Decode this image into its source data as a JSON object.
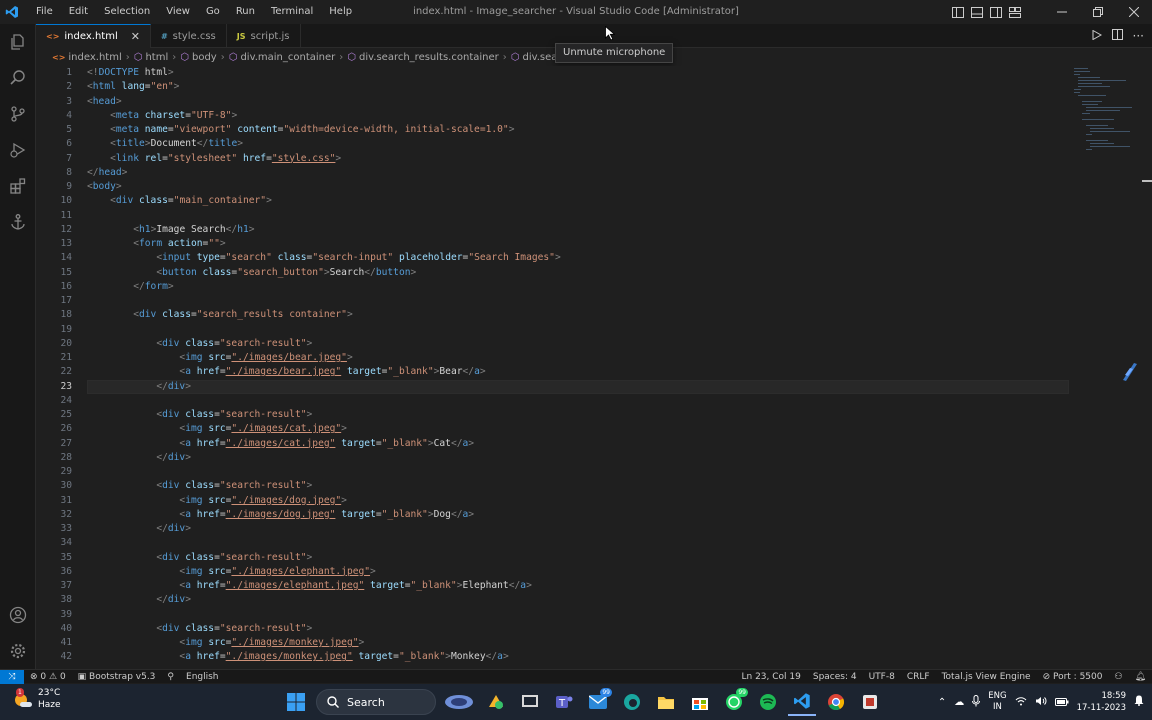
{
  "window": {
    "title": "index.html - Image_searcher - Visual Studio Code [Administrator]",
    "menu": [
      "File",
      "Edit",
      "Selection",
      "View",
      "Go",
      "Run",
      "Terminal",
      "Help"
    ]
  },
  "tabs": [
    {
      "label": "index.html",
      "icon": "<>",
      "active": true
    },
    {
      "label": "style.css",
      "icon": "#",
      "active": false
    },
    {
      "label": "script.js",
      "icon": "JS",
      "active": false
    }
  ],
  "breadcrumb": [
    "index.html",
    "html",
    "body",
    "div.main_container",
    "div.search_results.container",
    "div.search-result"
  ],
  "tooltip": "Unmute microphone",
  "editor": {
    "current_line": 23,
    "line_numbers": [
      "1",
      "2",
      "3",
      "4",
      "5",
      "6",
      "7",
      "8",
      "9",
      "10",
      "11",
      "12",
      "13",
      "14",
      "15",
      "16",
      "17",
      "18",
      "19",
      "20",
      "21",
      "22",
      "23",
      "24",
      "25",
      "26",
      "27",
      "28",
      "29",
      "30",
      "31",
      "32",
      "33",
      "34",
      "35",
      "36",
      "37",
      "38",
      "39",
      "40",
      "41",
      "42"
    ],
    "lines": [
      "<!DOCTYPE html>",
      "<html lang=\"en\">",
      "<head>",
      "    <meta charset=\"UTF-8\">",
      "    <meta name=\"viewport\" content=\"width=device-width, initial-scale=1.0\">",
      "    <title>Document</title>",
      "    <link rel=\"stylesheet\" href=\"style.css\">",
      "</head>",
      "<body>",
      "    <div class=\"main_container\">",
      "",
      "        <h1>Image Search</h1>",
      "        <form action=\"\">",
      "            <input type=\"search\" class=\"search-input\" placeholder=\"Search Images\">",
      "            <button class=\"search_button\">Search</button>",
      "        </form>",
      "",
      "        <div class=\"search_results container\">",
      "",
      "            <div class=\"search-result\">",
      "                <img src=\"./images/bear.jpeg\">",
      "                <a href=\"./images/bear.jpeg\" target=\"_blank\">Bear</a>",
      "            </div>",
      "",
      "            <div class=\"search-result\">",
      "                <img src=\"./images/cat.jpeg\">",
      "                <a href=\"./images/cat.jpeg\" target=\"_blank\">Cat</a>",
      "            </div>",
      "",
      "            <div class=\"search-result\">",
      "                <img src=\"./images/dog.jpeg\">",
      "                <a href=\"./images/dog.jpeg\" target=\"_blank\">Dog</a>",
      "            </div>",
      "",
      "            <div class=\"search-result\">",
      "                <img src=\"./images/elephant.jpeg\">",
      "                <a href=\"./images/elephant.jpeg\" target=\"_blank\">Elephant</a>",
      "            </div>",
      "",
      "            <div class=\"search-result\">",
      "                <img src=\"./images/monkey.jpeg\">",
      "                <a href=\"./images/monkey.jpeg\" target=\"_blank\">Monkey</a>"
    ]
  },
  "status": {
    "errors": "0",
    "warnings": "0",
    "bootstrap": "Bootstrap v5.3",
    "language_pack": "English",
    "position": "Ln 23, Col 19",
    "spaces": "Spaces: 4",
    "encoding": "UTF-8",
    "eol": "CRLF",
    "engine": "Total.js View Engine",
    "port": "Port : 5500"
  },
  "taskbar": {
    "weather_temp": "23°C",
    "weather_desc": "Haze",
    "weather_badge": "1",
    "search_label": "Search",
    "mail_badge": "99",
    "whatsapp_badge": "99",
    "lang_line1": "ENG",
    "lang_line2": "IN",
    "time": "18:59",
    "date": "17-11-2023"
  },
  "colors": {
    "accent": "#0078d4",
    "tag": "#569cd6",
    "attr": "#9cdcfe",
    "string": "#ce9178"
  }
}
